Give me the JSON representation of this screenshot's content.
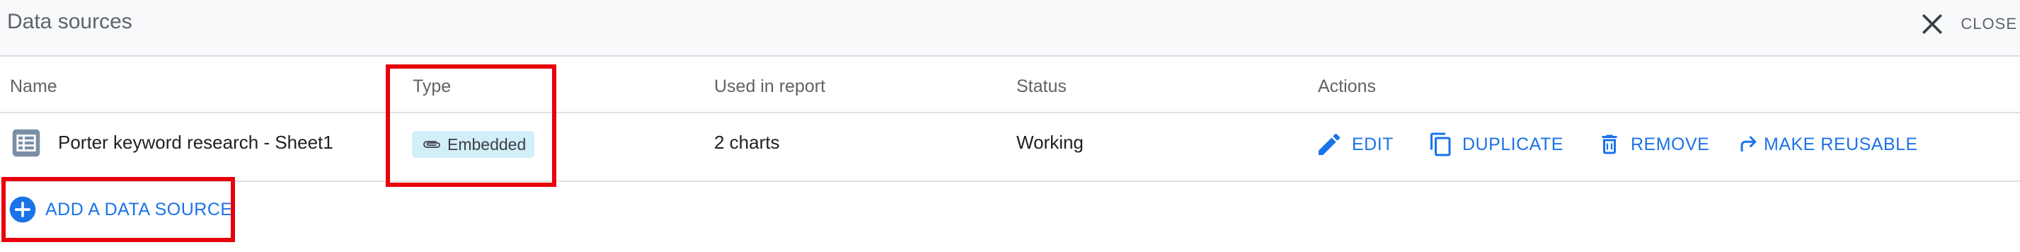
{
  "header": {
    "title": "Data sources",
    "close_label": "CLOSE"
  },
  "table": {
    "columns": [
      "Name",
      "Type",
      "Used in report",
      "Status",
      "Actions"
    ],
    "rows": [
      {
        "icon": "table-icon",
        "name": "Porter keyword research - Sheet1",
        "type": "Embedded",
        "type_icon": "paperclip-icon",
        "used_in_report": "2 charts",
        "status": "Working",
        "actions": [
          {
            "label": "EDIT",
            "icon": "pencil-icon"
          },
          {
            "label": "DUPLICATE",
            "icon": "copy-icon"
          },
          {
            "label": "REMOVE",
            "icon": "trash-icon"
          },
          {
            "label": "MAKE REUSABLE",
            "icon": "share-arrow-icon"
          }
        ]
      }
    ]
  },
  "add_source": {
    "label": "ADD A DATA SOURCE",
    "icon": "plus-circle-icon"
  },
  "colors": {
    "accent": "#1a73e8",
    "highlight": "#e8000b",
    "badge_bg": "#d2eef9"
  }
}
